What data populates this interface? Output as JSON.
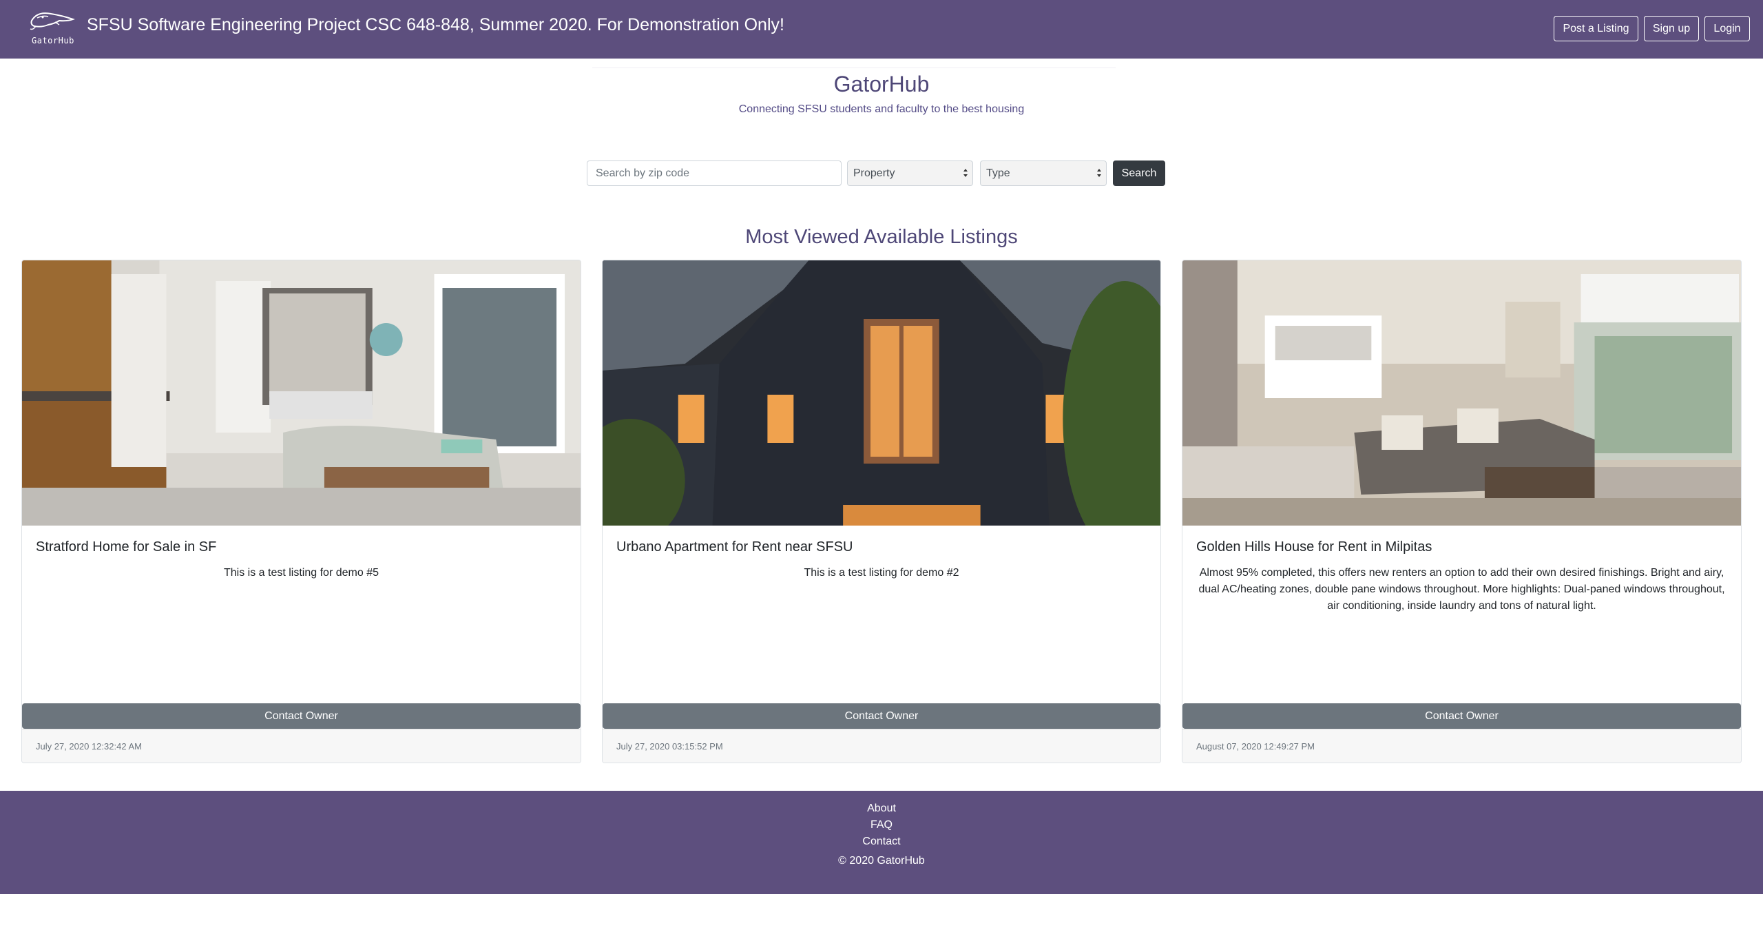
{
  "navbar": {
    "logo_text": "GatorHub",
    "title": "SFSU Software Engineering Project CSC 648-848, Summer 2020. For Demonstration Only!",
    "post_listing": "Post a Listing",
    "sign_up": "Sign up",
    "login": "Login",
    "logo_icon": "gator-icon"
  },
  "hero": {
    "title": "GatorHub",
    "subtitle": "Connecting SFSU students and faculty to the best housing"
  },
  "search": {
    "placeholder": "Search by zip code",
    "value": "",
    "property_selected": "Property",
    "type_selected": "Type",
    "button": "Search"
  },
  "section": {
    "title": "Most Viewed Available Listings"
  },
  "listings": [
    {
      "title": "Stratford Home for Sale in SF",
      "description": "This is a test listing for demo #5",
      "contact": "Contact Owner",
      "date": "July 27, 2020 12:32:42 AM"
    },
    {
      "title": "Urbano Apartment for Rent near SFSU",
      "description": "This is a test listing for demo #2",
      "contact": "Contact Owner",
      "date": "July 27, 2020 03:15:52 PM"
    },
    {
      "title": "Golden Hills House for Rent in Milpitas",
      "description": "Almost 95% completed, this offers new renters an option to add their own desired finishings. Bright and airy, dual AC/heating zones, double pane windows throughout. More highlights: Dual-paned windows throughout, air conditioning, inside laundry and tons of natural light.",
      "contact": "Contact Owner",
      "date": "August 07, 2020 12:49:27 PM"
    }
  ],
  "footer": {
    "about": "About",
    "faq": "FAQ",
    "contact": "Contact",
    "copyright": "© 2020 GatorHub"
  },
  "colors": {
    "navbar_bg": "#5d4f7e",
    "heading": "#4e4777",
    "search_button": "#343a40",
    "contact_button": "#6c757d"
  }
}
